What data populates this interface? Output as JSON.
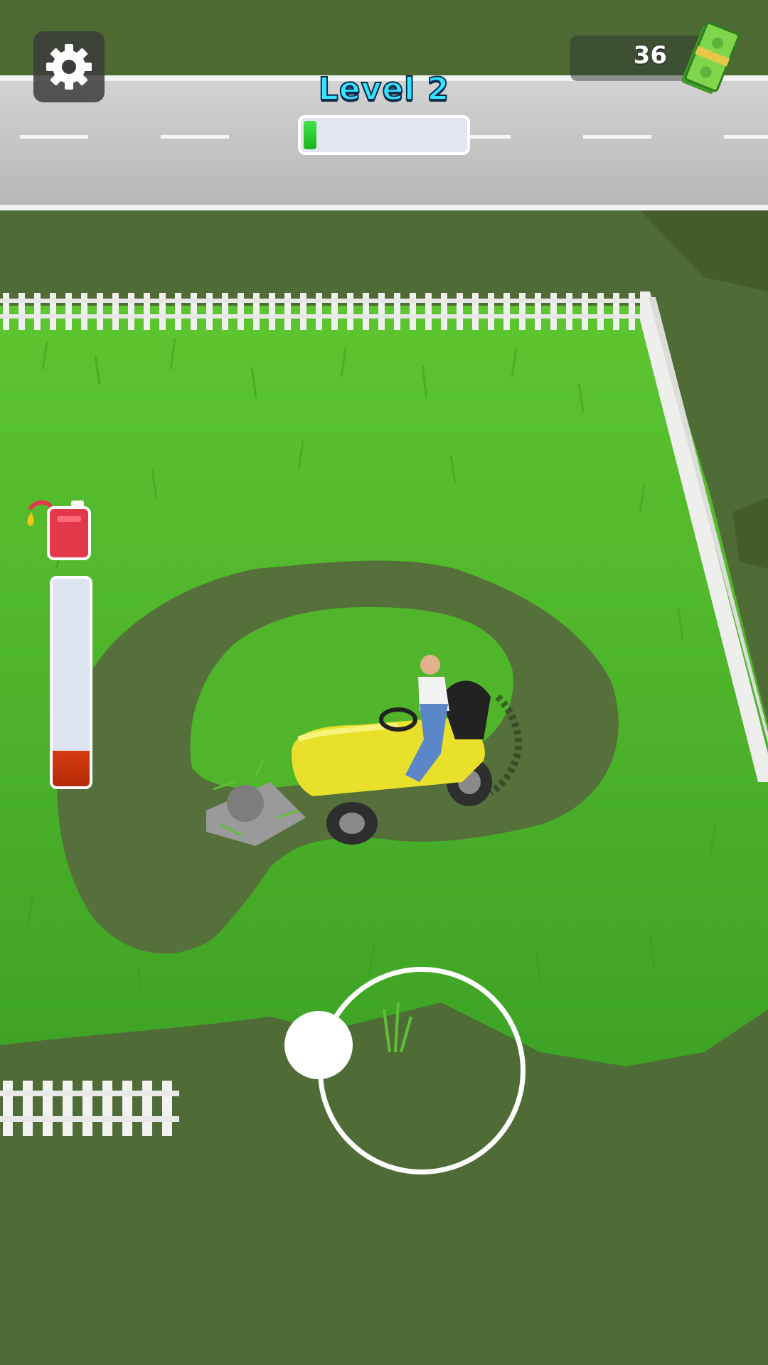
{
  "hud": {
    "settings_icon": "gear-icon",
    "cash": {
      "amount": "36",
      "icon": "cash-stack-icon"
    },
    "level": {
      "title": "Level 2",
      "progress": 0.08
    },
    "fuel": {
      "icon": "fuel-can-icon",
      "level": 0.17
    }
  },
  "joystick": {
    "knob_icon": "joystick-knob"
  },
  "colors": {
    "level_title": "#33e3ff",
    "progress_fill": "#29cc2e",
    "fuel_fill": "#c9320c",
    "fuel_can": "#e2384a",
    "grass_tall": "#4fb82c",
    "grass_mowed": "#4f6b35",
    "road": "#c4c5c4",
    "mower": "#e8e02a"
  }
}
